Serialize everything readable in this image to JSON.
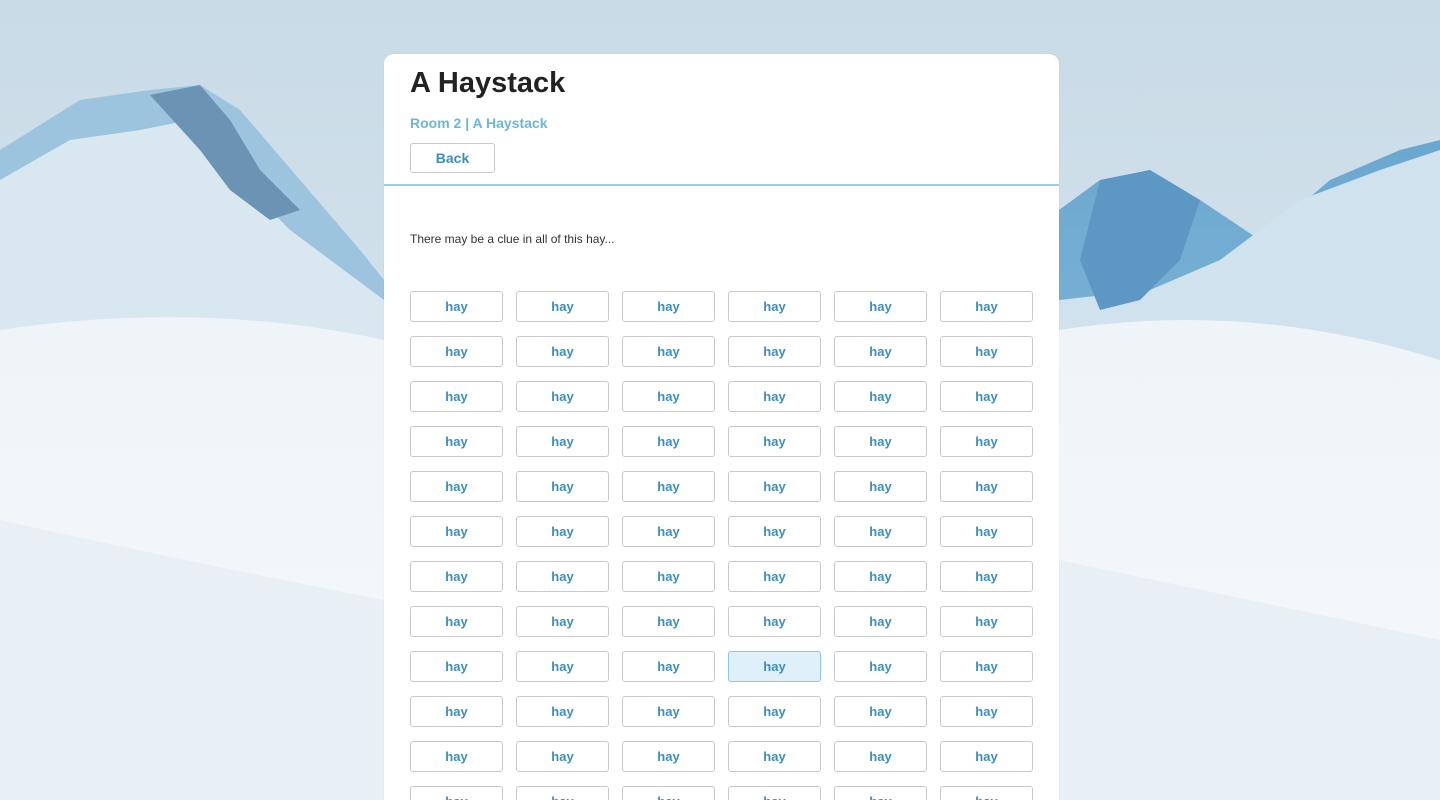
{
  "page": {
    "title": "A Haystack",
    "breadcrumb": "Room 2 | A Haystack",
    "back_label": "Back",
    "clue_text": "There may be a clue in all of this hay..."
  },
  "grid": {
    "button_label": "hay",
    "columns": 6,
    "visible_rows": 12,
    "highlighted_row": 9,
    "highlighted_col": 4
  },
  "colors": {
    "accent": "#3a8fc0",
    "breadcrumb": "#6cb6d6",
    "divider": "#9fcde3",
    "highlight": "#dff0fb"
  }
}
